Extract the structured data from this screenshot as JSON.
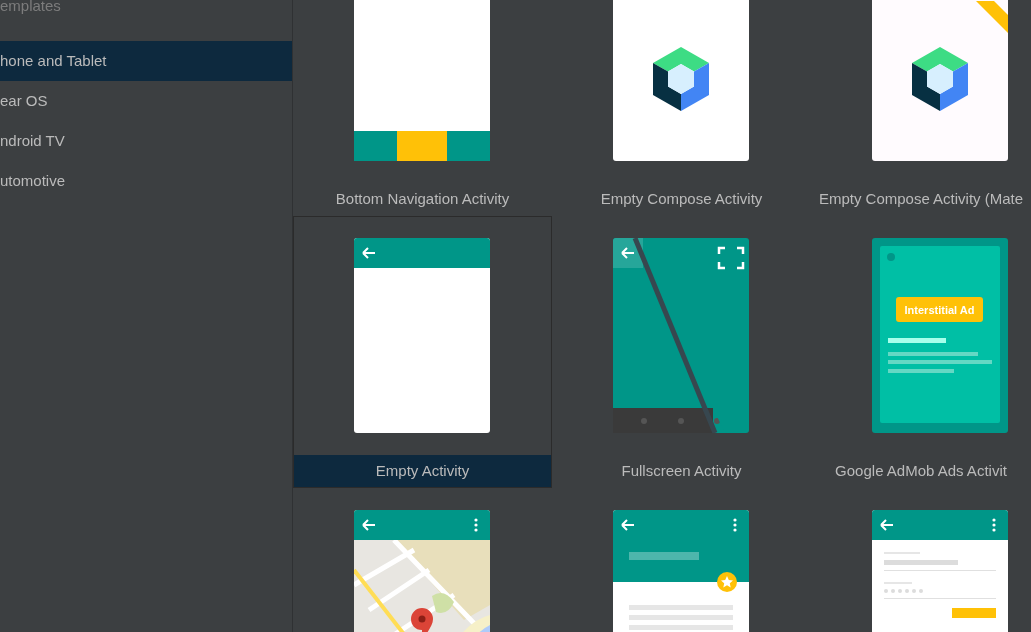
{
  "sidebar": {
    "title": "emplates",
    "items": [
      {
        "label": "hone and Tablet",
        "selected": true
      },
      {
        "label": "ear OS",
        "selected": false
      },
      {
        "label": "ndroid TV",
        "selected": false
      },
      {
        "label": "utomotive",
        "selected": false
      }
    ]
  },
  "templates": [
    {
      "kind": "bottom-nav",
      "label": "Bottom Navigation Activity",
      "selected": false
    },
    {
      "kind": "compose",
      "label": "Empty Compose Activity",
      "selected": false
    },
    {
      "kind": "compose-material",
      "label": "Empty Compose Activity (Mate",
      "selected": false
    },
    {
      "kind": "empty",
      "label": "Empty Activity",
      "selected": true
    },
    {
      "kind": "fullscreen",
      "label": "Fullscreen Activity",
      "selected": false
    },
    {
      "kind": "admob",
      "label": "Google AdMob Ads Activit",
      "badge": "Interstitial Ad",
      "selected": false
    },
    {
      "kind": "maps",
      "selected": false
    },
    {
      "kind": "scrolling",
      "selected": false
    },
    {
      "kind": "login",
      "selected": false
    }
  ]
}
